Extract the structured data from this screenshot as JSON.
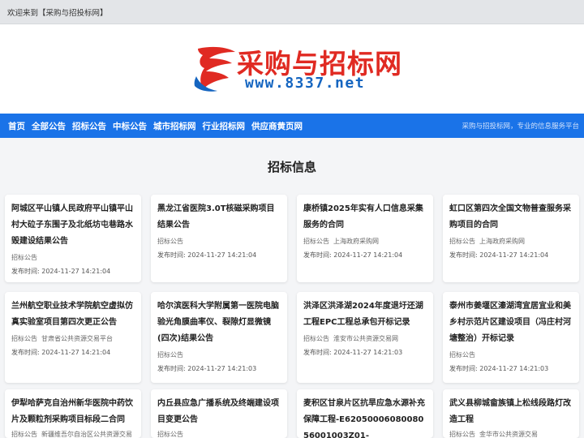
{
  "topbar": {
    "welcome": "欢迎来到【采购与招投标网】"
  },
  "logo": {
    "title": "采购与招标网",
    "url": "www.8337.net",
    "brand_red": "#e02a22",
    "brand_blue": "#1565c0"
  },
  "nav": {
    "items": [
      "首页",
      "全部公告",
      "招标公告",
      "中标公告",
      "城市招标网",
      "行业招标网",
      "供应商黄页网"
    ],
    "slogan": "采购与招投标网，专业的信息服务平台",
    "color": "#1a73e8"
  },
  "section": {
    "title": "招标信息"
  },
  "date_label": "发布时间:",
  "cards": [
    {
      "title": "阿城区平山镇人民政府平山镇平山村大砬子东围子及北纸坊屯巷路水毁建设结果公告",
      "category": "招标公告",
      "source": "",
      "date": "2024-11-27 14:21:04"
    },
    {
      "title": "黑龙江省医院3.0T核磁采购项目结果公告",
      "category": "招标公告",
      "source": "",
      "date": "2024-11-27 14:21:04"
    },
    {
      "title": "康桥镇2025年实有人口信息采集服务的合同",
      "category": "招标公告",
      "source": "上海政府采购网",
      "date": "2024-11-27 14:21:04"
    },
    {
      "title": "虹口区第四次全国文物普查服务采购项目的合同",
      "category": "招标公告",
      "source": "上海政府采购网",
      "date": "2024-11-27 14:21:04"
    },
    {
      "title": "兰州航空职业技术学院航空虚拟仿真实验室项目第四次更正公告",
      "category": "招标公告",
      "source": "甘肃省公共资源交易平台",
      "date": "2024-11-27 14:21:04"
    },
    {
      "title": "哈尔滨医科大学附属第一医院电脑验光角膜曲率仪、裂隙灯显微镜(四次)结果公告",
      "category": "招标公告",
      "source": "",
      "date": "2024-11-27 14:21:03"
    },
    {
      "title": "洪泽区洪泽湖2024年度退圩还湖工程EPC工程总承包开标记录",
      "category": "招标公告",
      "source": "淮安市公共资源交易网",
      "date": "2024-11-27 14:21:03"
    },
    {
      "title": "泰州市姜堰区溱湖湾宜居宜业和美乡村示范片区建设项目（冯庄村河塘整治）开标记录",
      "category": "招标公告",
      "source": "",
      "date": "2024-11-27 14:21:03"
    },
    {
      "title": "伊犁哈萨克自治州新华医院中药饮片及颗粒剂采购项目标段二合同",
      "category": "招标公告",
      "source": "新疆维吾尔自治区公共资源交易",
      "date": ""
    },
    {
      "title": "内丘县应急广播系统及终端建设项目变更公告",
      "category": "招标公告",
      "source": "",
      "date": ""
    },
    {
      "title": "麦积区甘泉片区抗旱应急水源补充保障工程-E6205000608008056001003Z01-",
      "category": "",
      "source": "",
      "date": ""
    },
    {
      "title": "武义县柳城畲族镇上松线段路灯改造工程",
      "category": "招标公告",
      "source": "金华市公共资源交易",
      "date": ""
    }
  ]
}
